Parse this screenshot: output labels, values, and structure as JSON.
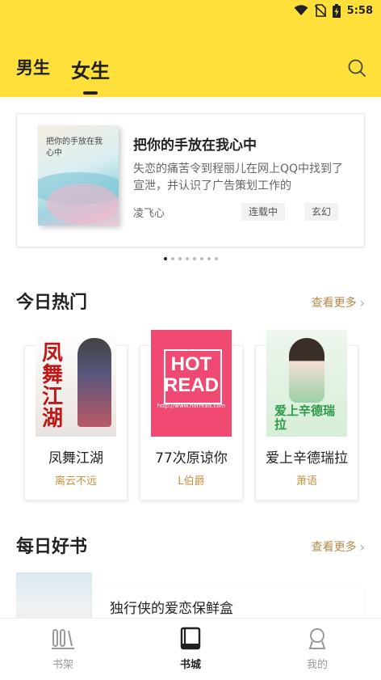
{
  "status_bar": {
    "time": "5:58",
    "icons": [
      "wifi-icon",
      "no-sim-icon",
      "battery-charging-icon"
    ]
  },
  "header": {
    "tabs": [
      {
        "label": "男生",
        "active": false
      },
      {
        "label": "女生",
        "active": true
      }
    ],
    "search_icon": "search-icon"
  },
  "banner": {
    "cover_text": "把你的手放在我心中",
    "title": "把你的手放在我心中",
    "description": "失恋的痛苦令到程丽儿在网上QQ中找到了宣泄，并认识了广告策划工作的",
    "author": "凌飞心",
    "tags": [
      "连载中",
      "玄幻"
    ],
    "dots_total": 8,
    "dots_active_index": 0
  },
  "hot_today": {
    "title": "今日热门",
    "more": "查看更多",
    "books": [
      {
        "name": "凤舞江湖",
        "author": "离云不远",
        "cover_text": "凤舞江湖"
      },
      {
        "name": "77次原谅你",
        "author": "L伯爵",
        "cover_text": "HOT READ",
        "cover_url": "http://www.hotread.com"
      },
      {
        "name": "爱上辛德瑞拉",
        "author": "萧语",
        "cover_text": "爱上辛德瑞拉"
      }
    ]
  },
  "daily_good": {
    "title": "每日好书",
    "more": "查看更多",
    "book": {
      "name": "独行侠的爱恋保鲜盒"
    }
  },
  "tabbar": {
    "items": [
      {
        "label": "书架",
        "icon": "bookshelf-icon",
        "active": false
      },
      {
        "label": "书城",
        "icon": "book-store-icon",
        "active": true
      },
      {
        "label": "我的",
        "icon": "profile-icon",
        "active": false
      }
    ]
  },
  "colors": {
    "header_bg": "#ffe03a",
    "accent_author": "#c8913f",
    "more_link": "#b8894a"
  }
}
